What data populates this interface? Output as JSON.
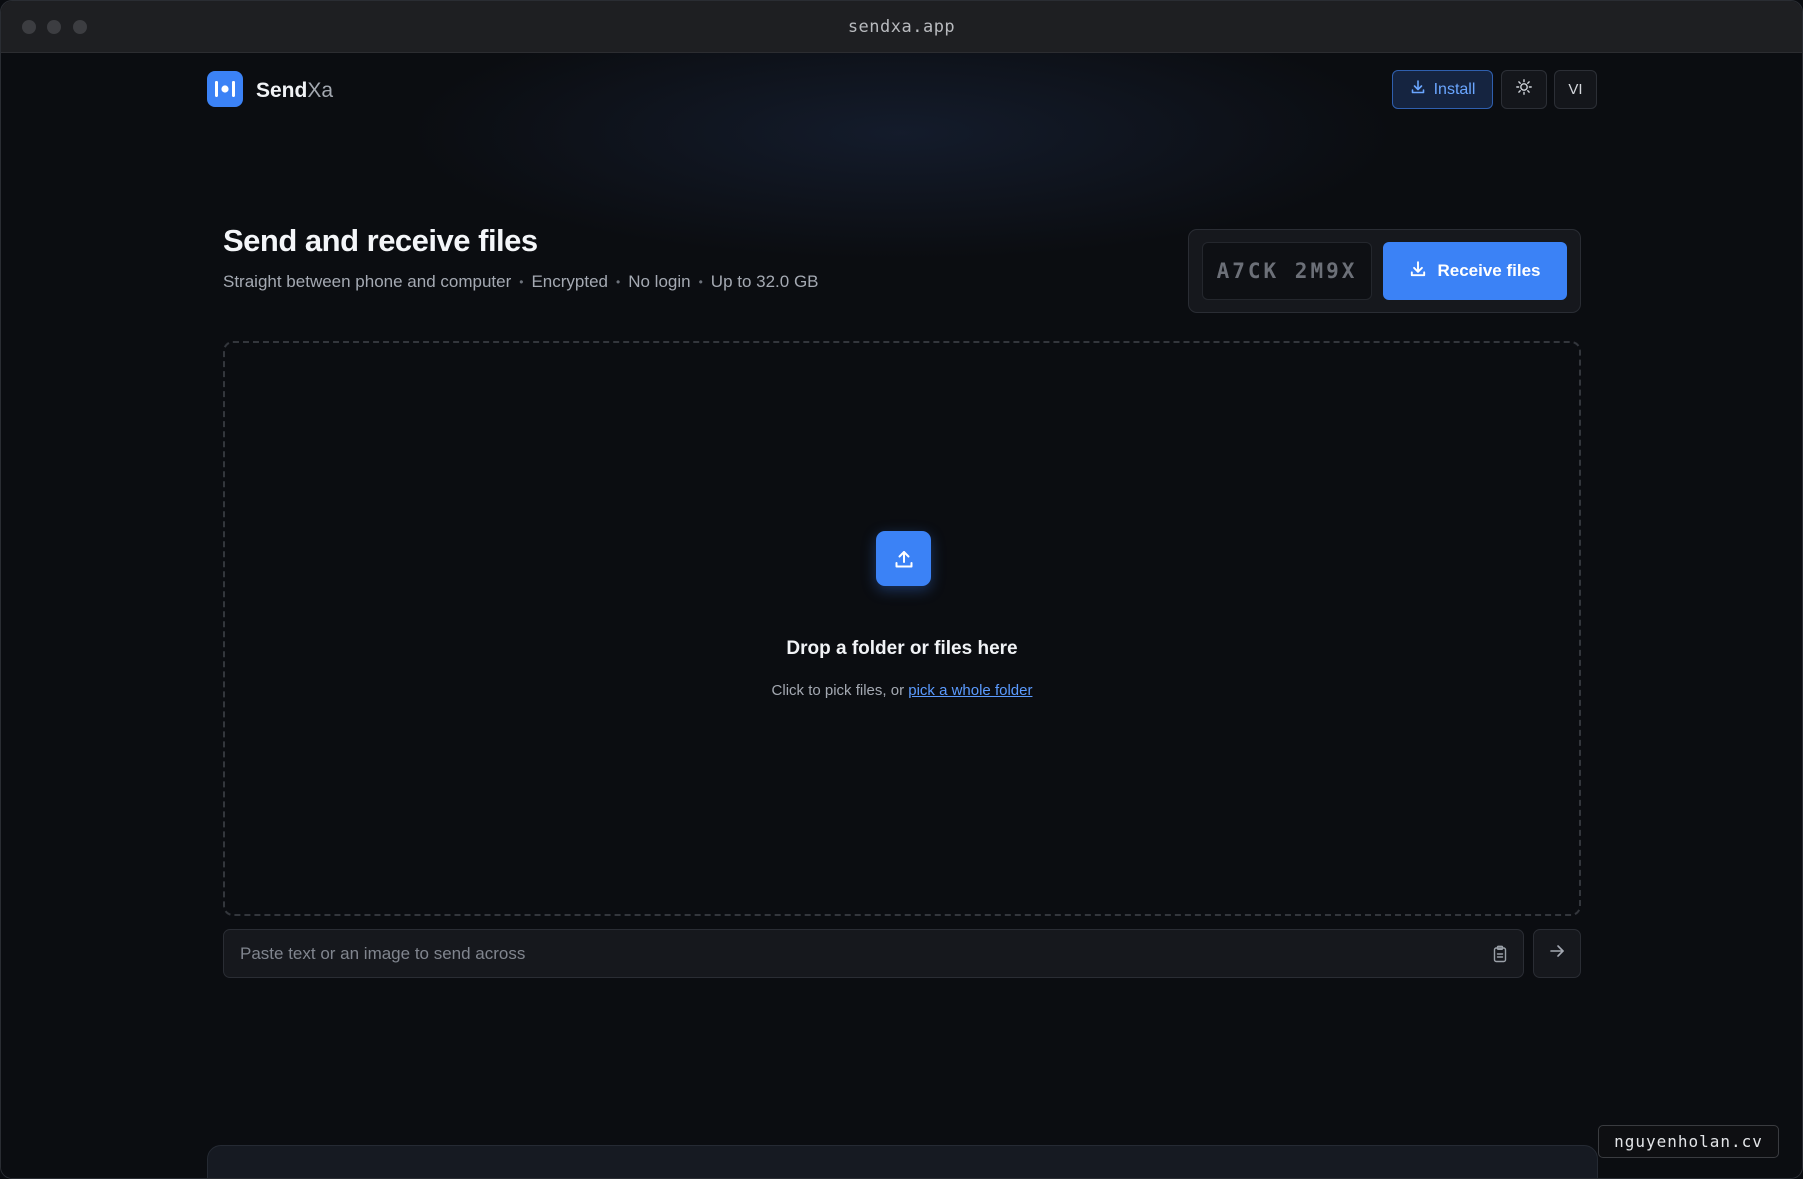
{
  "window": {
    "title": "sendxa.app"
  },
  "header": {
    "brand_part1": "Send",
    "brand_part2": "Xa",
    "install_label": "Install",
    "language_label": "VI"
  },
  "hero": {
    "title": "Send and receive files",
    "features": [
      "Straight between phone and computer",
      "Encrypted",
      "No login",
      "Up to 32.0 GB"
    ],
    "separator": "•"
  },
  "receive": {
    "code_placeholder": "A7CK 2M9X",
    "button_label": "Receive files"
  },
  "dropzone": {
    "title": "Drop a folder or files here",
    "hint_prefix": "Click to pick files, or ",
    "hint_link": "pick a whole folder"
  },
  "paste": {
    "placeholder": "Paste text or an image to send across"
  },
  "watermark": "nguyenholan.cv",
  "colors": {
    "accent": "#3b82f6",
    "background": "#0b0d11",
    "link": "#5b9bff"
  },
  "icons": {
    "install": "download-icon",
    "theme": "sun-icon",
    "receive": "download-icon",
    "upload": "upload-icon",
    "clipboard": "clipboard-icon",
    "send": "arrow-right-icon"
  }
}
